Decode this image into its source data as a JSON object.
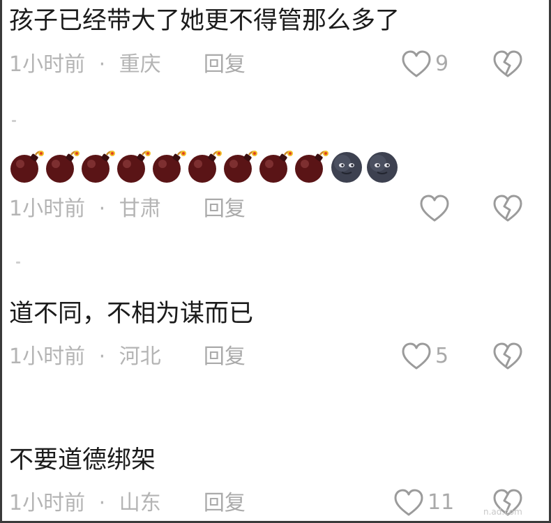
{
  "comments": [
    {
      "text": "孩子已经带大了她更不得管那么多了",
      "time": "1小时前",
      "dot": "·",
      "location": "重庆",
      "reply_label": "回复",
      "like_count": "9"
    },
    {
      "text": "",
      "emojis": [
        "bomb",
        "bomb",
        "bomb",
        "bomb",
        "bomb",
        "bomb",
        "bomb",
        "bomb",
        "bomb",
        "new-moon-face",
        "new-moon-face"
      ],
      "time": "1小时前",
      "dot": "·",
      "location": "甘肃",
      "reply_label": "回复",
      "like_count": ""
    },
    {
      "text": "道不同，不相为谋而已",
      "time": "1小时前",
      "dot": "·",
      "location": "河北",
      "reply_label": "回复",
      "like_count": "5"
    },
    {
      "text": "不要道德绑架",
      "time": "1小时前",
      "dot": "·",
      "location": "山东",
      "reply_label": "回复",
      "like_count": "11"
    }
  ],
  "watermark": "n.ad.com",
  "colors": {
    "text": "#1b1b1b",
    "meta": "#b4b4b4",
    "icon_stroke": "#9b9b9b",
    "border": "#3a3a3a"
  },
  "icons": {
    "like": "heart-outline-icon",
    "dislike": "broken-heart-icon"
  }
}
